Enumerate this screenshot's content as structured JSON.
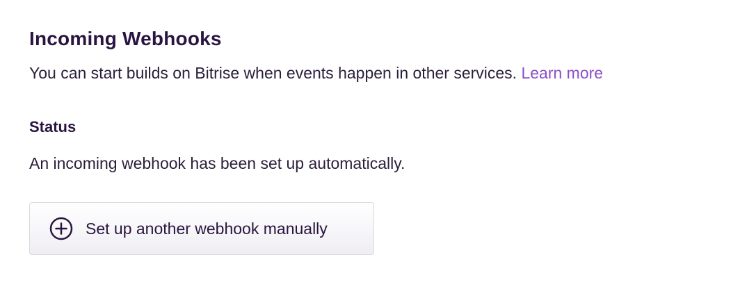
{
  "header": {
    "title": "Incoming Webhooks",
    "description": "You can start builds on Bitrise when events happen in other services.",
    "learn_more_label": "Learn more"
  },
  "status": {
    "heading": "Status",
    "text": "An incoming webhook has been set up automatically."
  },
  "actions": {
    "setup_button_label": "Set up another webhook manually",
    "setup_button_icon": "plus-circle-icon"
  },
  "colors": {
    "heading": "#2a1540",
    "link": "#8a4fc7",
    "button_border": "#dcd8e0"
  }
}
